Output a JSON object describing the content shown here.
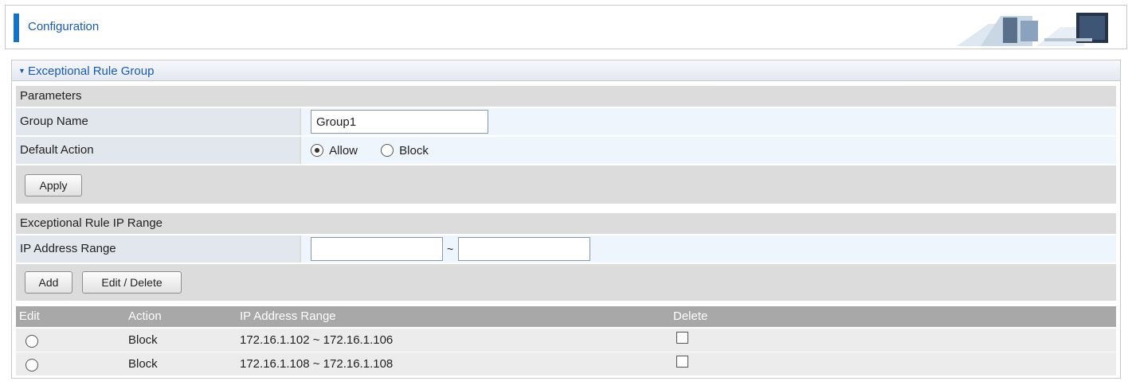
{
  "header": {
    "title": "Configuration",
    "art_icon": "office-desk-banner-icon"
  },
  "panel": {
    "title": "Exceptional Rule Group"
  },
  "parameters": {
    "section_title": "Parameters",
    "group_name": {
      "label": "Group Name",
      "value": "Group1"
    },
    "default_action": {
      "label": "Default Action",
      "options": [
        "Allow",
        "Block"
      ],
      "selected": "Allow"
    },
    "apply_label": "Apply"
  },
  "ip_range": {
    "section_title": "Exceptional Rule IP Range",
    "label": "IP Address Range",
    "separator": "~",
    "from_value": "",
    "to_value": "",
    "add_label": "Add",
    "edit_delete_label": "Edit / Delete"
  },
  "table": {
    "headers": [
      "Edit",
      "Action",
      "IP Address Range",
      "Delete"
    ],
    "rows": [
      {
        "action": "Block",
        "range": "172.16.1.102 ~ 172.16.1.106"
      },
      {
        "action": "Block",
        "range": "172.16.1.108 ~ 172.16.1.108"
      }
    ]
  },
  "colors": {
    "accent": "#1673c4",
    "title_text": "#1a5aa8",
    "table_header": "#a8a8a8"
  }
}
